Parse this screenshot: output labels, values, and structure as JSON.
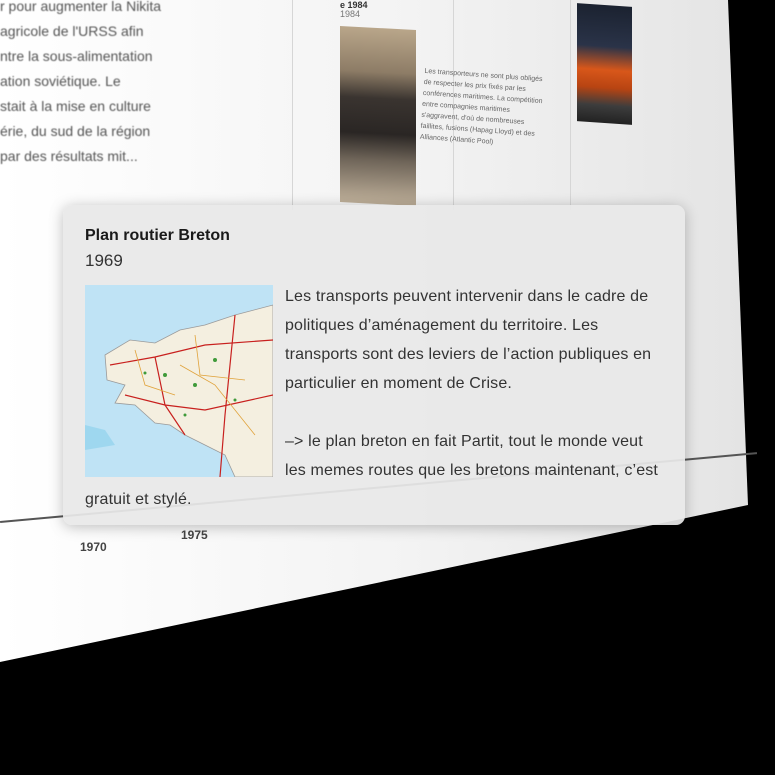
{
  "background_page": {
    "left_column_lines": [
      "r pour augmenter la",
      "agricole de l'URSS afin",
      "ntre la sous-alimentation",
      "ation soviétique. Le",
      "stait à la mise en culture",
      "érie, du sud de la région",
      "par des résultats mit..."
    ],
    "left_column_fragment": "Nikita",
    "ship_event_year": "1984",
    "ship_event_title_fragment": "e 1984",
    "ship_event_text": "Les transporteurs ne sont plus obligés de respecter les prix fixés par les conférences maritimes. La compétition entre compagnies maritimes s'aggravent, d'où de nombreuses faillites, fusions (Hapag Lloyd) et des Alliances (Atlantic Pool)",
    "axis_ticks": [
      "1970",
      "1975"
    ]
  },
  "popover": {
    "title": "Plan routier Breton",
    "year": "1969",
    "paragraph_1": "Les transports peuvent intervenir dans le cadre de politiques d’aménagement du territoire. Les transports sont des leviers de l’action publiques en particulier en moment de Crise.",
    "paragraph_2": "–> le plan breton en fait Partit, tout le monde veut les memes routes que les bretons maintenant, c’est gratuit et stylé.",
    "map_image": "map-of-brittany-roads"
  },
  "colors": {
    "popover_bg": "#e8e8e8",
    "page_bg": "#f4f4f4",
    "backdrop": "#000000"
  }
}
